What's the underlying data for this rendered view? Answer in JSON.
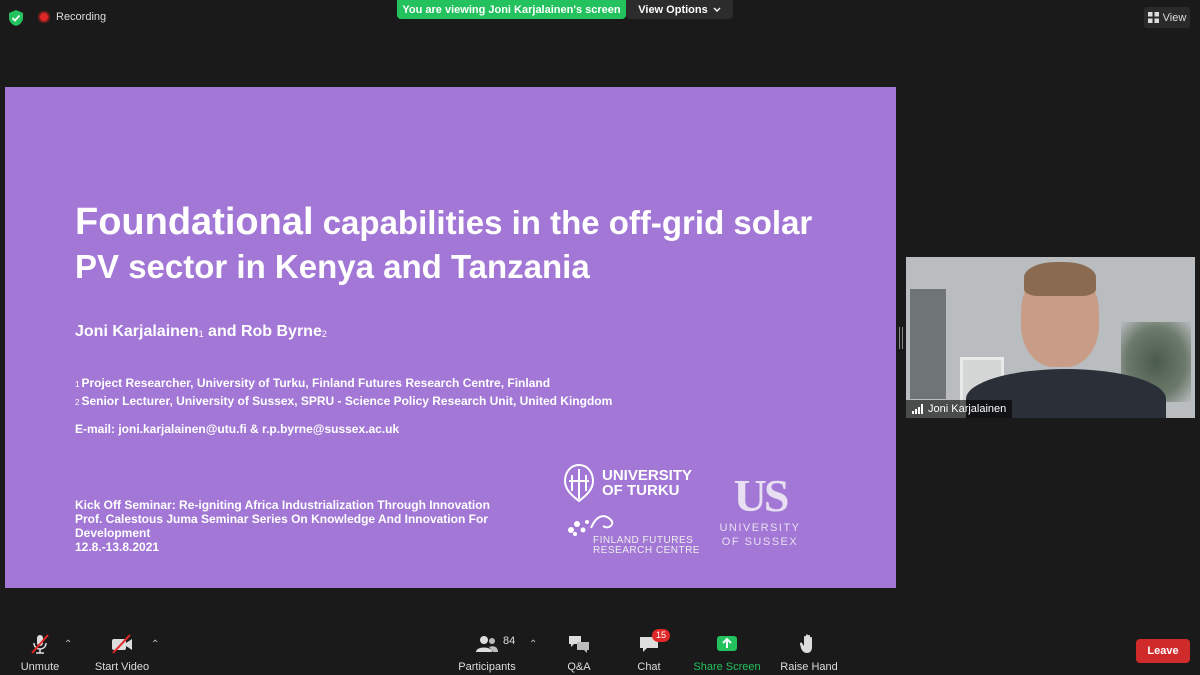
{
  "topbar": {
    "recording_label": "Recording",
    "viewing_banner": "You are viewing Joni Karjalainen's screen",
    "view_options_label": "View Options",
    "view_label": "View",
    "banner_color": "#23c25e"
  },
  "slide": {
    "title_word_large": "Foundational",
    "title_rest": " capabilities in the off-grid solar PV sector in Kenya and Tanzania",
    "author1": "Joni Karjalainen",
    "author1_sup": "1",
    "author_and": " and ",
    "author2": "Rob Byrne",
    "author2_sup": "2",
    "affiliation1_num": "1",
    "affiliation1": "Project Researcher, University of Turku, Finland Futures Research Centre, Finland",
    "affiliation2_num": "2",
    "affiliation2": "Senior Lecturer, University of Sussex, SPRU - Science Policy Research Unit, United Kingdom",
    "email": "E-mail: joni.karjalainen@utu.fi & r.p.byrne@sussex.ac.uk",
    "seminar_line1": "Kick Off Seminar: Re-igniting Africa Industrialization Through Innovation",
    "seminar_line2": "Prof. Calestous Juma Seminar Series On Knowledge And Innovation For Development",
    "seminar_dates": "12.8.-13.8.2021",
    "logo_turku_line1": "UNIVERSITY",
    "logo_turku_line2": "OF TURKU",
    "logo_ffrc_line1": "FINLAND FUTURES",
    "logo_ffrc_line2": "RESEARCH CENTRE",
    "logo_sussex_mark": "US",
    "logo_sussex_line1": "UNIVERSITY",
    "logo_sussex_line2": "OF SUSSEX",
    "background_color": "#a277d6"
  },
  "video": {
    "participant_name": "Joni Karjalainen"
  },
  "toolbar": {
    "unmute_label": "Unmute",
    "start_video_label": "Start Video",
    "participants_label": "Participants",
    "participants_count": "84",
    "qa_label": "Q&A",
    "chat_label": "Chat",
    "chat_badge": "15",
    "share_screen_label": "Share Screen",
    "raise_hand_label": "Raise Hand",
    "leave_label": "Leave",
    "leave_color": "#cf2b2b"
  }
}
